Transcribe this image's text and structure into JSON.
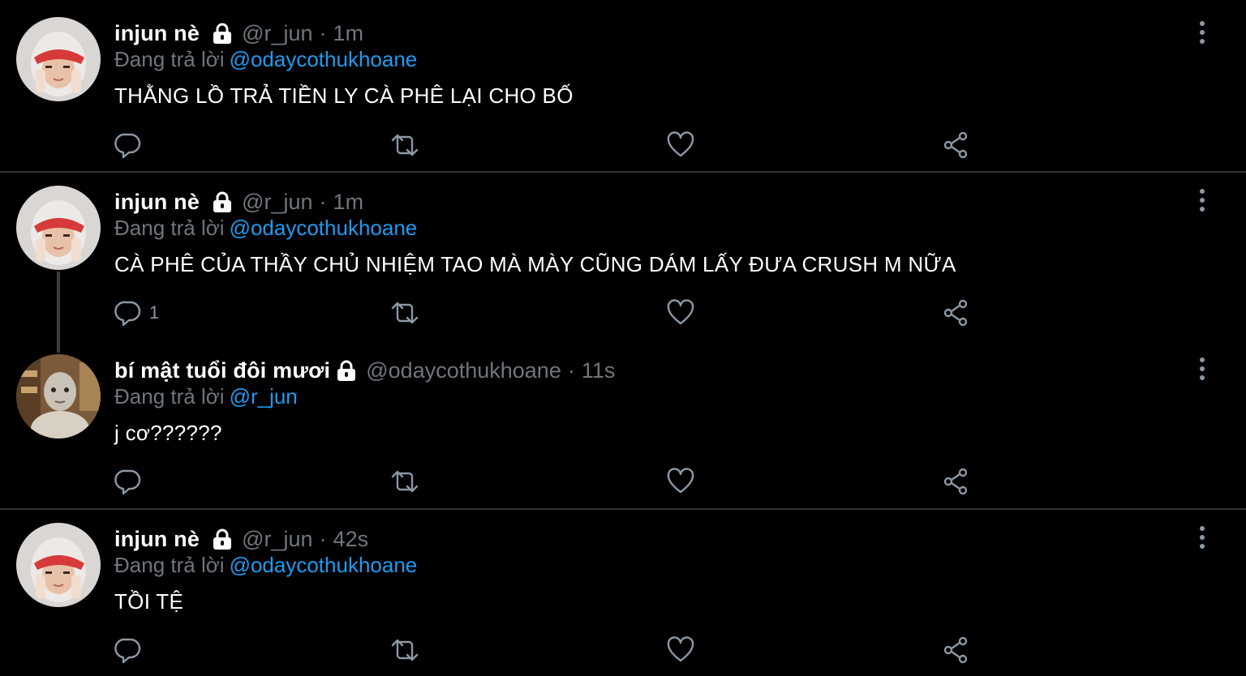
{
  "reply_prefix": "Đang trả lời",
  "dot": "·",
  "colors": {
    "background": "#000000",
    "muted": "#6e767d",
    "link": "#1d9bf0",
    "divider": "#2f3336"
  },
  "icons": [
    "reply-icon",
    "retweet-icon",
    "like-icon",
    "share-icon",
    "more-icon",
    "lock-icon"
  ],
  "tweets": [
    {
      "name": "injun nè",
      "handle": "@r_jun",
      "time": "1m",
      "reply_to": "@odaycothukhoane",
      "text": "THẰNG LỒ TRẢ TIỀN LY CÀ PHÊ LẠI CHO BỐ",
      "reply_count": ""
    },
    {
      "name": "injun nè",
      "handle": "@r_jun",
      "time": "1m",
      "reply_to": "@odaycothukhoane",
      "text": "CÀ PHÊ CỦA THẦY CHỦ NHIỆM TAO MÀ MÀY CŨNG DÁM LẤY ĐƯA CRUSH M NỮA",
      "reply_count": "1"
    },
    {
      "name": "bí mật tuổi đôi mươi",
      "handle": "@odaycothukhoane",
      "time": "11s",
      "reply_to": "@r_jun",
      "text": "j cơ??????",
      "reply_count": ""
    },
    {
      "name": "injun nè",
      "handle": "@r_jun",
      "time": "42s",
      "reply_to": "@odaycothukhoane",
      "text": "TỒI TỆ",
      "reply_count": ""
    }
  ]
}
